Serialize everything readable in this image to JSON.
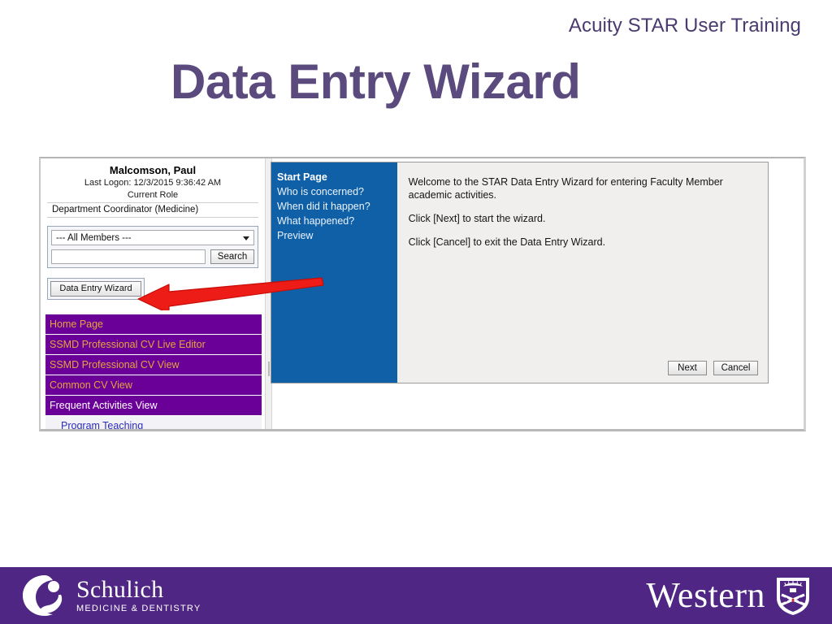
{
  "slide": {
    "kicker": "Acuity STAR User Training",
    "title": "Data Entry Wizard"
  },
  "app": {
    "user": {
      "name": "Malcomson, Paul",
      "last_logon": "Last Logon: 12/3/2015 9:36:42 AM",
      "current_role_label": "Current Role",
      "current_role_value": "Department Coordinator (Medicine)"
    },
    "member_filter": {
      "selected_option": "--- All Members ---",
      "options": [
        "--- All Members ---"
      ],
      "search_value": "",
      "search_placeholder": "",
      "search_button": "Search"
    },
    "data_entry_wizard_button": "Data Entry Wizard",
    "nav_items": [
      {
        "label": "Home Page",
        "style": "gold"
      },
      {
        "label": "SSMD Professional CV Live Editor",
        "style": "gold"
      },
      {
        "label": "SSMD Professional CV View",
        "style": "gold"
      },
      {
        "label": "Common CV View",
        "style": "gold"
      },
      {
        "label": "Frequent Activities View",
        "style": "white"
      }
    ],
    "nav_sub_item": "Program Teaching"
  },
  "wizard": {
    "steps": [
      {
        "label": "Start Page",
        "current": true
      },
      {
        "label": "Who is concerned?",
        "current": false
      },
      {
        "label": "When did it happen?",
        "current": false
      },
      {
        "label": "What happened?",
        "current": false
      },
      {
        "label": "Preview",
        "current": false
      }
    ],
    "body": {
      "paragraph_1": "Welcome to the STAR Data Entry Wizard for entering Faculty Member academic activities.",
      "paragraph_2": "Click [Next] to start the wizard.",
      "paragraph_3": "Click [Cancel] to exit the Data Entry Wizard."
    },
    "next_button": "Next",
    "cancel_button": "Cancel"
  },
  "annotation": {
    "arrow_color": "#ED1C16"
  },
  "footer": {
    "background": "#4F2683",
    "schulich_name": "Schulich",
    "schulich_sub": "MEDICINE & DENTISTRY",
    "western_name": "Western"
  }
}
